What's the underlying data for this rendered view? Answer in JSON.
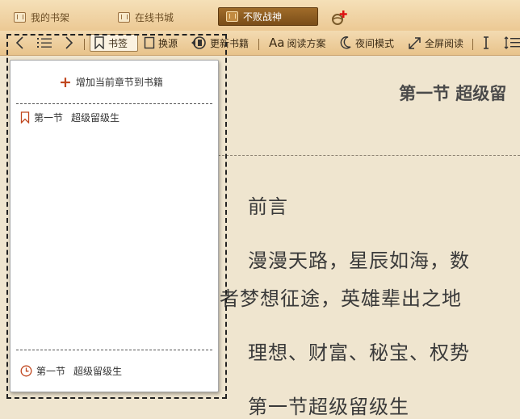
{
  "tabs": [
    {
      "label": "我的书架"
    },
    {
      "label": "在线书城"
    },
    {
      "label": "不败战神"
    }
  ],
  "toolbar": {
    "bookmark_label": "书签",
    "source_label": "换源",
    "update_label": "更新书籍",
    "scheme_label": "阅读方案",
    "night_label": "夜间模式",
    "fullscreen_label": "全屏阅读",
    "font_icon_text": "Aa"
  },
  "bookmark_popup": {
    "add_label": "增加当前章节到书籍",
    "bookmark": {
      "chapter": "第一节",
      "title": "超级留级生"
    },
    "recent": {
      "chapter": "第一节",
      "title": "超级留级生"
    }
  },
  "content": {
    "chapter_title": "第一节 超级留",
    "lines": [
      "前言",
      "漫漫天路，星辰如海，数",
      "者梦想征途，英雄辈出之地",
      "理想、财富、秘宝、权势",
      "第一节超级留级生"
    ]
  },
  "colors": {
    "accent": "#c0471f",
    "paper": "#efe5cf",
    "active_tab": "#7a4d18"
  }
}
